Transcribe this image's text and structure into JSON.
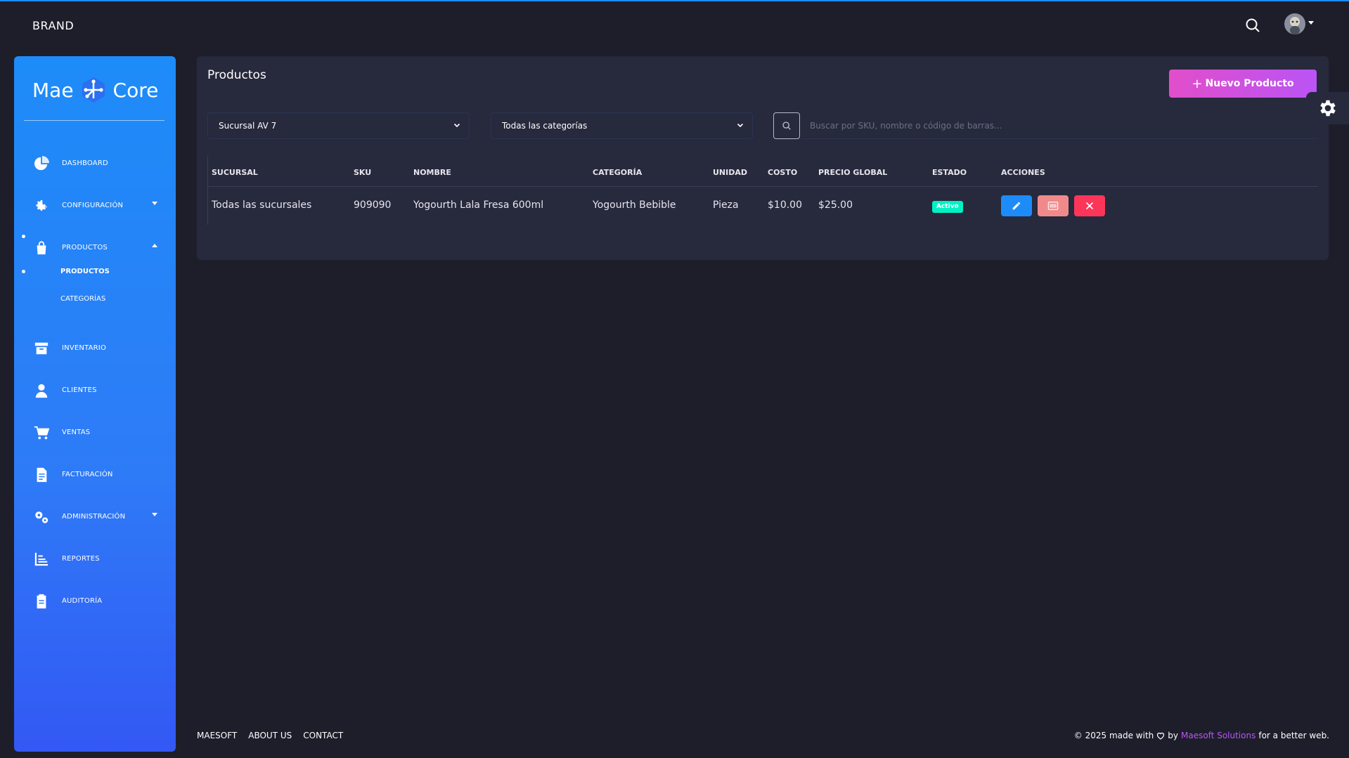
{
  "header": {
    "brand": "BRAND"
  },
  "sidebar": {
    "logo_left": "Mae",
    "logo_right": "Core",
    "items": [
      {
        "label": "DASHBOARD",
        "icon": "pie-chart-icon"
      },
      {
        "label": "CONFIGURACIÓN",
        "icon": "gear-icon"
      },
      {
        "label": "PRODUCTOS",
        "icon": "shopping-bag-icon"
      },
      {
        "label": "INVENTARIO",
        "icon": "archive-icon"
      },
      {
        "label": "CLIENTES",
        "icon": "user-icon"
      },
      {
        "label": "VENTAS",
        "icon": "cart-icon"
      },
      {
        "label": "FACTURACIÓN",
        "icon": "document-icon"
      },
      {
        "label": "ADMINISTRACIÓN",
        "icon": "gears-icon"
      },
      {
        "label": "REPORTES",
        "icon": "chart-list-icon"
      },
      {
        "label": "AUDITORÍA",
        "icon": "clipboard-icon"
      }
    ],
    "sub_items": [
      {
        "label": "PRODUCTOS"
      },
      {
        "label": "CATEGORÍAS"
      }
    ]
  },
  "main": {
    "title": "Productos",
    "new_button": "Nuevo Producto",
    "branch_select": "Sucursal AV 7",
    "category_select": "Todas las categorías",
    "search_placeholder": "Buscar por SKU, nombre o código de barras...",
    "table": {
      "headers": [
        "SUCURSAL",
        "SKU",
        "NOMBRE",
        "CATEGORÍA",
        "UNIDAD",
        "COSTO",
        "PRECIO GLOBAL",
        "ESTADO",
        "ACCIONES"
      ],
      "rows": [
        {
          "sucursal": "Todas las sucursales",
          "sku": "909090",
          "nombre": "Yogourth Lala Fresa 600ml",
          "categoria": "Yogourth Bebible",
          "unidad": "Pieza",
          "costo": "$10.00",
          "precio": "$25.00",
          "estado": "Activo"
        }
      ]
    }
  },
  "footer": {
    "links": [
      "MAESOFT",
      "ABOUT US",
      "CONTACT"
    ],
    "copyright_prefix": "© 2025 made with",
    "copyright_by": "by",
    "copyright_link": "Maesoft Solutions",
    "copyright_suffix": "for a better web."
  },
  "colors": {
    "background": "#1e1e2b",
    "card": "#27293d",
    "primary": "#1d8cf8",
    "accent": "#e14eca",
    "success": "#00f2c3",
    "danger": "#fd3659"
  }
}
